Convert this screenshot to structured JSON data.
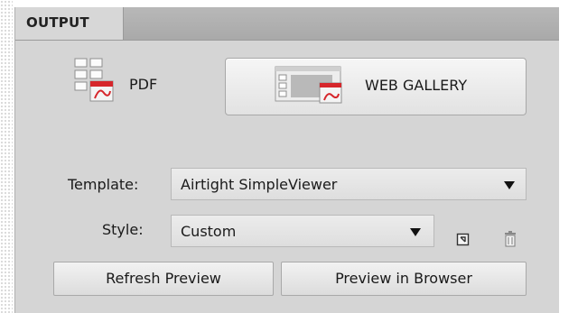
{
  "panel": {
    "tab_label": "OUTPUT"
  },
  "formats": {
    "pdf": {
      "label": "PDF",
      "icon": "pdf-layout-icon"
    },
    "web_gallery": {
      "label": "WEB GALLERY",
      "icon": "web-gallery-icon",
      "selected": true
    }
  },
  "template": {
    "label": "Template:",
    "value": "Airtight SimpleViewer"
  },
  "style": {
    "label": "Style:",
    "value": "Custom",
    "save_icon": "save-style-icon",
    "delete_icon": "trash-icon"
  },
  "buttons": {
    "refresh_preview": "Refresh Preview",
    "preview_in_browser": "Preview in Browser"
  },
  "colors": {
    "panel_bg": "#d5d5d5",
    "tabbar_bg": "#a9a9a9",
    "adobe_red": "#d6262b"
  }
}
